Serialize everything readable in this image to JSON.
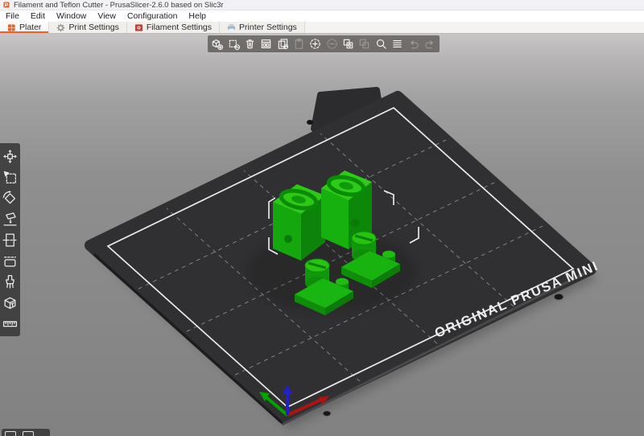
{
  "window": {
    "title": "Filament and Teflon Cutter - PrusaSlicer-2.6.0 based on Slic3r",
    "app_icon": "prusaslicer-logo-icon"
  },
  "menubar": {
    "items": [
      {
        "label": "File"
      },
      {
        "label": "Edit"
      },
      {
        "label": "Window"
      },
      {
        "label": "View"
      },
      {
        "label": "Configuration"
      },
      {
        "label": "Help"
      }
    ]
  },
  "tabbar": {
    "tabs": [
      {
        "label": "Plater",
        "icon": "plater-icon",
        "selected": true
      },
      {
        "label": "Print Settings",
        "icon": "gear-icon",
        "selected": false
      },
      {
        "label": "Filament Settings",
        "icon": "filament-spool-icon",
        "selected": false
      },
      {
        "label": "Printer Settings",
        "icon": "printer-icon",
        "selected": false
      }
    ]
  },
  "toolbar": {
    "items": [
      {
        "name": "add",
        "enabled": true
      },
      {
        "name": "delete",
        "enabled": true
      },
      {
        "name": "delete-all",
        "enabled": true
      },
      {
        "name": "arrange",
        "enabled": true
      },
      {
        "name": "copy",
        "enabled": true
      },
      {
        "name": "paste",
        "enabled": false
      },
      {
        "name": "add-instance",
        "enabled": true
      },
      {
        "name": "remove-instance",
        "enabled": false
      },
      {
        "name": "split-to-objects",
        "enabled": true
      },
      {
        "name": "split-to-parts",
        "enabled": false
      },
      {
        "name": "search",
        "enabled": true
      },
      {
        "name": "variable-layer-height",
        "enabled": true
      },
      {
        "name": "undo",
        "enabled": false
      },
      {
        "name": "redo",
        "enabled": false
      }
    ]
  },
  "gizmobar": {
    "items": [
      {
        "name": "move"
      },
      {
        "name": "scale"
      },
      {
        "name": "rotate"
      },
      {
        "name": "place-on-face"
      },
      {
        "name": "cut"
      },
      {
        "name": "paint-on-supports"
      },
      {
        "name": "seam-painting"
      },
      {
        "name": "text-emboss"
      },
      {
        "name": "measure"
      }
    ]
  },
  "bottom_toolbar": {
    "items": [
      {
        "name": "clipped-icon-left"
      },
      {
        "name": "clipped-icon-right"
      }
    ]
  },
  "scene": {
    "bed_label": "ORIGINAL PRUSA MINI",
    "object_count": 4,
    "selection_active": true
  },
  "colors": {
    "accent": "#e8622b",
    "model_green": "#16b40e",
    "bed_plate": "#303032",
    "bed_border": "#e9e9e9",
    "axis_x": "#b01212",
    "axis_y": "#00a400",
    "axis_z": "#2020cc",
    "viewport_top": "#c7c5c5",
    "viewport_bottom": "#828181"
  }
}
